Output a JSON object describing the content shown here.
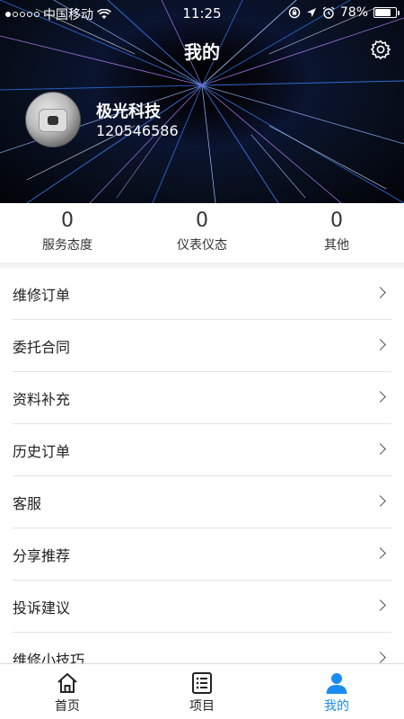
{
  "status_bar": {
    "carrier": "中国移动",
    "time": "11:25",
    "battery_percent": "78%",
    "battery_level": 0.78,
    "icons": [
      "signal-dots-icon",
      "wifi-icon",
      "orientation-lock-icon",
      "location-arrow-icon",
      "alarm-icon",
      "battery-icon"
    ]
  },
  "header": {
    "title": "我的",
    "settings_icon": "gear-icon"
  },
  "profile": {
    "name": "极光科技",
    "id": "120546586"
  },
  "stats": [
    {
      "value": "0",
      "label": "服务态度"
    },
    {
      "value": "0",
      "label": "仪表仪态"
    },
    {
      "value": "0",
      "label": "其他"
    }
  ],
  "menu": [
    {
      "label": "维修订单"
    },
    {
      "label": "委托合同"
    },
    {
      "label": "资料补充"
    },
    {
      "label": "历史订单"
    },
    {
      "label": "客服"
    },
    {
      "label": "分享推荐"
    },
    {
      "label": "投诉建议"
    },
    {
      "label": "维修小技巧"
    }
  ],
  "tabbar": {
    "home": {
      "label": "首页",
      "icon": "home-icon"
    },
    "projects": {
      "label": "项目",
      "icon": "list-icon"
    },
    "mine": {
      "label": "我的",
      "icon": "person-icon"
    },
    "active": "mine",
    "active_color": "#1a8cf0"
  }
}
